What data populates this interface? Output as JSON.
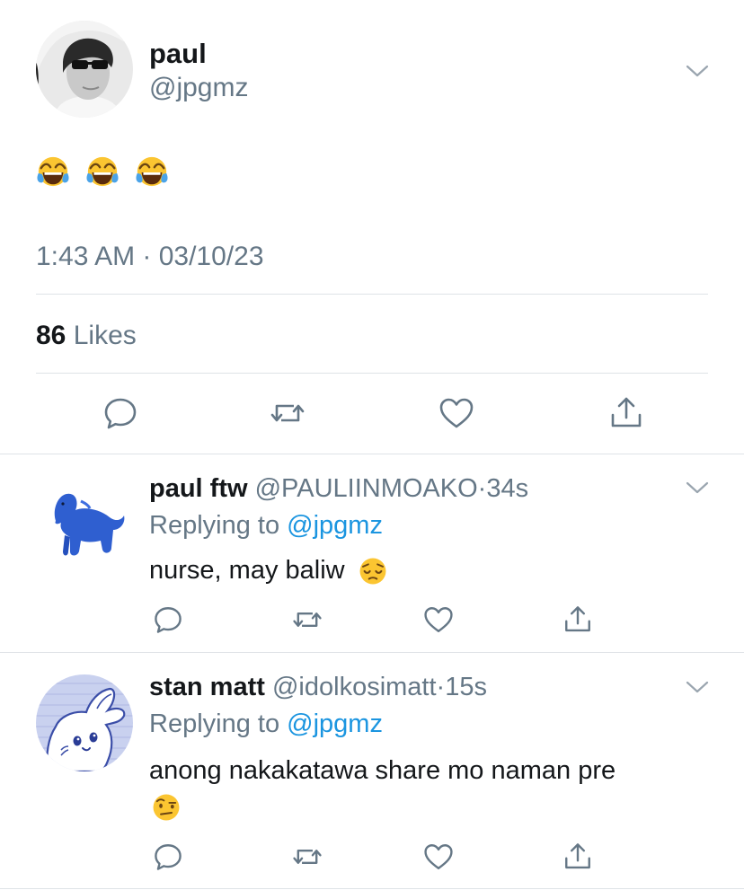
{
  "main_tweet": {
    "display_name": "paul",
    "handle": "@jpgmz",
    "body_emojis": [
      "face-with-tears-of-joy",
      "face-with-tears-of-joy",
      "face-with-tears-of-joy"
    ],
    "timestamp": "1:43 AM · 03/10/23",
    "likes_count": "86",
    "likes_label": "Likes"
  },
  "replies": [
    {
      "display_name": "paul ftw",
      "handle": "@PAULIINMOAKO",
      "separator": "·",
      "time": "34s",
      "replying_prefix": "Replying to",
      "replying_handle": "@jpgmz",
      "text": "nurse, may baliw",
      "text_emoji": "pensive-face",
      "avatar": "blue-dinosaur-plush"
    },
    {
      "display_name": "stan matt",
      "handle": "@idolkosimatt",
      "separator": "·",
      "time": "15s",
      "replying_prefix": "Replying to",
      "replying_handle": "@jpgmz",
      "text": "anong nakakatawa share mo naman pre",
      "text_emoji": "face-with-raised-eyebrow",
      "avatar": "white-rabbit-cartoon"
    }
  ],
  "colors": {
    "text": "#14171a",
    "secondary": "#657786",
    "link": "#1b95e0",
    "divider": "#dfe3e7"
  }
}
